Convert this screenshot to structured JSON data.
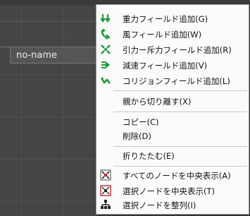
{
  "canvas": {
    "node_title": "no-name"
  },
  "context_menu": {
    "groups": [
      [
        {
          "label": "重力フィールド追加(G)",
          "icon": "gravity-field-icon"
        },
        {
          "label": "風フィールド追加(W)",
          "icon": "wind-field-icon"
        },
        {
          "label": "引力ー斥力フィールド追加(R)",
          "icon": "attract-repel-field-icon"
        },
        {
          "label": "減速フィールド追加(V)",
          "icon": "deceleration-field-icon"
        },
        {
          "label": "コリジョンフィールド追加(L)",
          "icon": "collision-field-icon"
        }
      ],
      [
        {
          "label": "親から切り離す(X)",
          "icon": ""
        }
      ],
      [
        {
          "label": "コピー(C)",
          "icon": ""
        },
        {
          "label": "削除(D)",
          "icon": ""
        }
      ],
      [
        {
          "label": "折りたたむ(E)",
          "icon": ""
        }
      ],
      [
        {
          "label": "すべてのノードを中央表示(A)",
          "icon": "center-all-nodes-icon"
        },
        {
          "label": "選択ノードを中央表示(T)",
          "icon": "center-selected-node-icon"
        },
        {
          "label": "選択ノードを整列(I)",
          "icon": "align-selected-nodes-icon"
        }
      ]
    ]
  }
}
